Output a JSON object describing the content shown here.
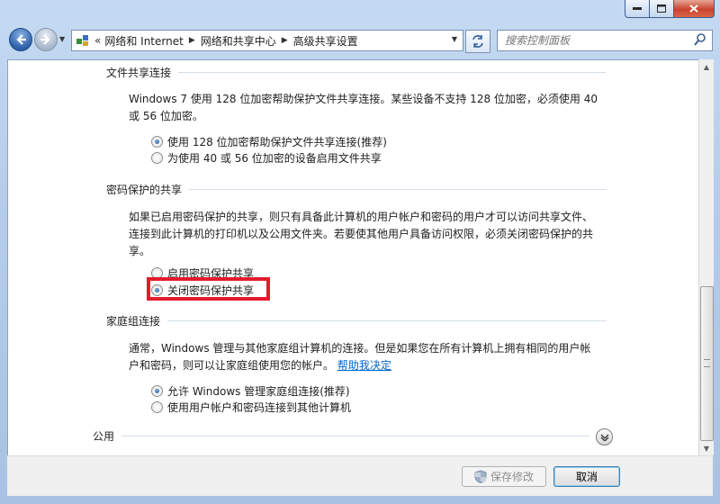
{
  "window": {
    "caption_buttons": {
      "minimize": "▭",
      "maximize": "▢",
      "close": "✕"
    }
  },
  "nav": {
    "back_icon": "arrow-left-icon",
    "forward_icon": "arrow-right-icon",
    "address_overflow": "«",
    "breadcrumbs": [
      "网络和 Internet",
      "网络和共享中心",
      "高级共享设置"
    ],
    "search_placeholder": "搜索控制面板"
  },
  "sections": {
    "file_sharing": {
      "header": "文件共享连接",
      "description": "Windows 7 使用 128 位加密帮助保护文件共享连接。某些设备不支持 128 位加密，必须使用 40 或 56 位加密。",
      "options": [
        {
          "label": "使用 128 位加密帮助保护文件共享连接(推荐)",
          "checked": true
        },
        {
          "label": "为使用 40 或 56 位加密的设备启用文件共享",
          "checked": false
        }
      ]
    },
    "password_sharing": {
      "header": "密码保护的共享",
      "description": "如果已启用密码保护的共享，则只有具备此计算机的用户帐户和密码的用户才可以访问共享文件、连接到此计算机的打印机以及公用文件夹。若要使其他用户具备访问权限，必须关闭密码保护的共享。",
      "options": [
        {
          "label": "启用密码保护共享",
          "checked": false
        },
        {
          "label": "关闭密码保护共享",
          "checked": true
        }
      ]
    },
    "homegroup": {
      "header": "家庭组连接",
      "description": "通常，Windows 管理与其他家庭组计算机的连接。但是如果您在所有计算机上拥有相同的用户帐户和密码，则可以让家庭组使用您的帐户。",
      "help_link": "帮助我决定",
      "options": [
        {
          "label": "允许 Windows 管理家庭组连接(推荐)",
          "checked": true
        },
        {
          "label": "使用用户帐户和密码连接到其他计算机",
          "checked": false
        }
      ]
    },
    "public": {
      "header": "公用"
    }
  },
  "footer": {
    "save_label": "保存修改",
    "cancel_label": "取消"
  },
  "colors": {
    "highlight_border": "#e21c2c",
    "link": "#0066cc"
  }
}
